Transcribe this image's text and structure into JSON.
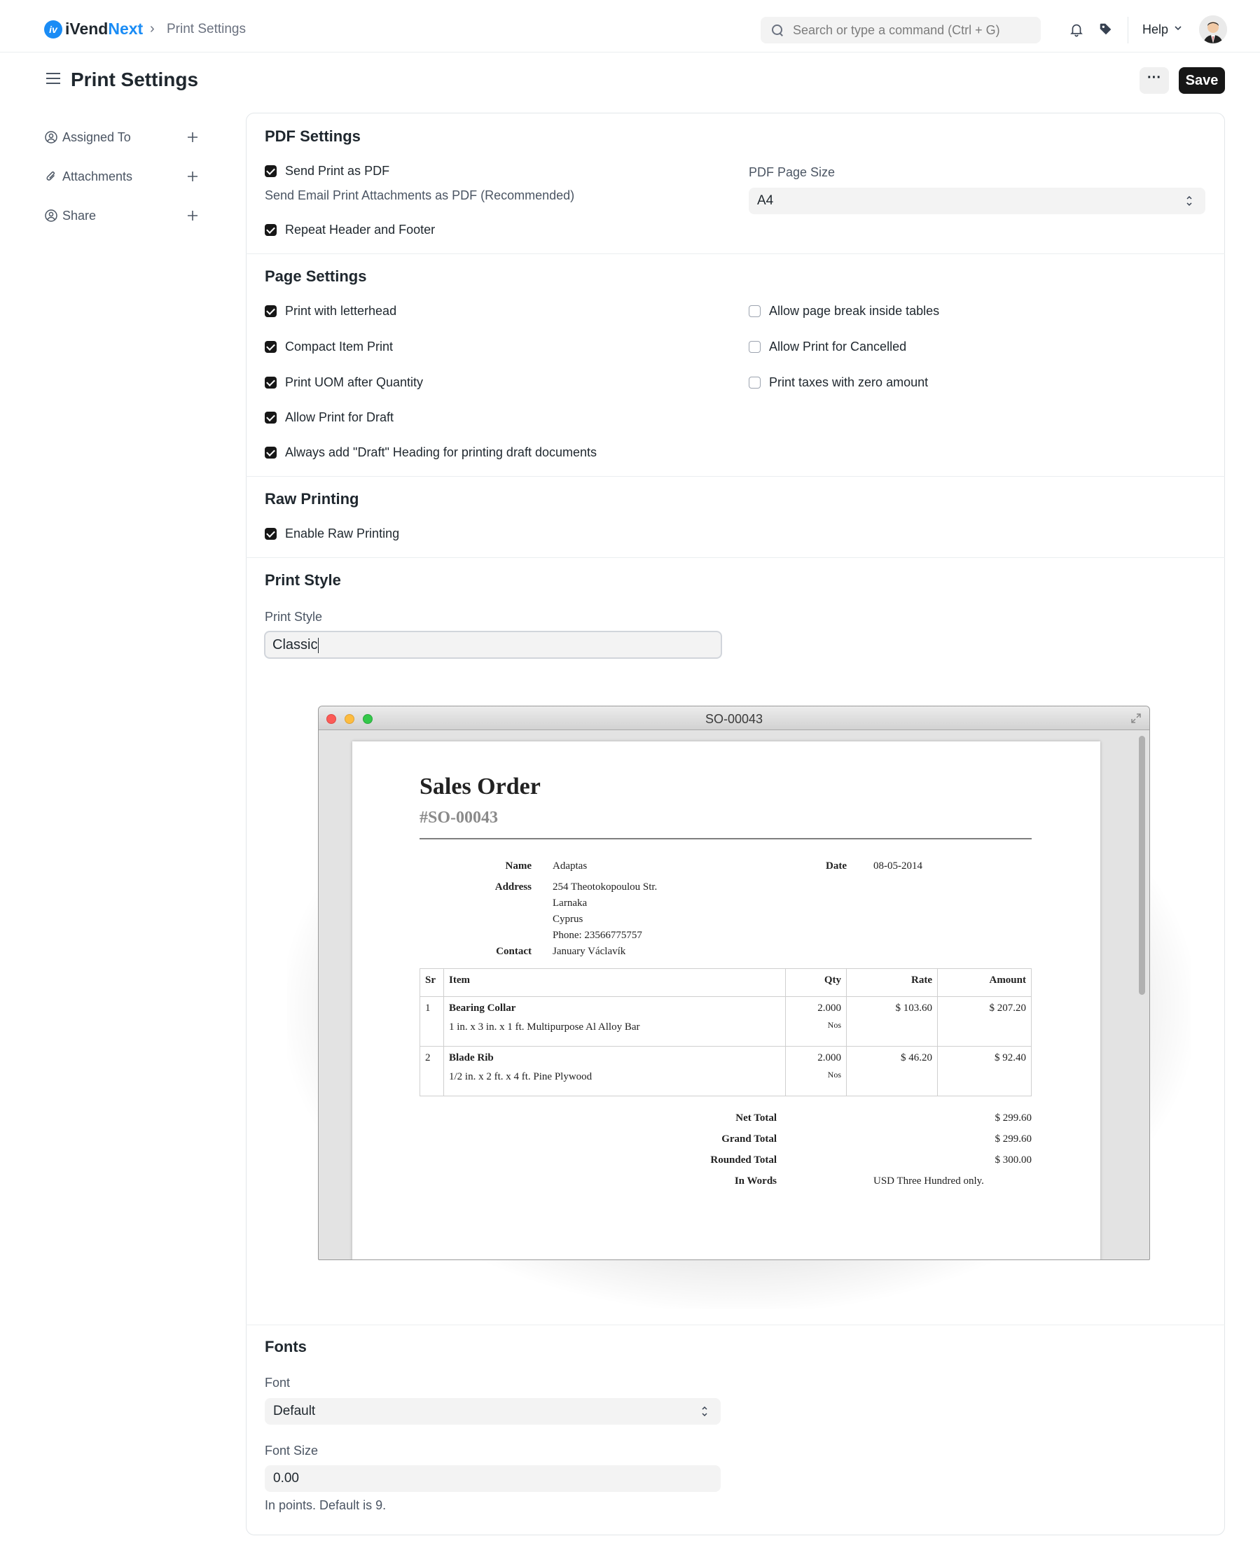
{
  "app": {
    "logo_mark": "iv",
    "logo_text_1": "iVend",
    "logo_text_2": "Next"
  },
  "breadcrumb": {
    "sep": "›",
    "current": "Print Settings"
  },
  "search": {
    "placeholder": "Search or type a command (Ctrl + G)"
  },
  "nav": {
    "help_label": "Help"
  },
  "page": {
    "title": "Print Settings",
    "more_label": "···",
    "save_label": "Save"
  },
  "sidebar": {
    "items": [
      {
        "label": "Assigned To",
        "icon": "user-add-icon"
      },
      {
        "label": "Attachments",
        "icon": "paperclip-icon"
      },
      {
        "label": "Share",
        "icon": "share-user-icon"
      }
    ]
  },
  "pdf_settings": {
    "title": "PDF Settings",
    "send_print_as_pdf": {
      "label": "Send Print as PDF",
      "checked": true
    },
    "send_print_help": "Send Email Print Attachments as PDF (Recommended)",
    "repeat_header_footer": {
      "label": "Repeat Header and Footer",
      "checked": true
    },
    "page_size_label": "PDF Page Size",
    "page_size_value": "A4"
  },
  "page_settings": {
    "title": "Page Settings",
    "left": [
      {
        "label": "Print with letterhead",
        "checked": true
      },
      {
        "label": "Compact Item Print",
        "checked": true
      },
      {
        "label": "Print UOM after Quantity",
        "checked": true
      },
      {
        "label": "Allow Print for Draft",
        "checked": true
      },
      {
        "label": "Always add \"Draft\" Heading for printing draft documents",
        "checked": true
      }
    ],
    "right": [
      {
        "label": "Allow page break inside tables",
        "checked": false
      },
      {
        "label": "Allow Print for Cancelled",
        "checked": false
      },
      {
        "label": "Print taxes with zero amount",
        "checked": false
      }
    ]
  },
  "raw_printing": {
    "title": "Raw Printing",
    "enable": {
      "label": "Enable Raw Printing",
      "checked": true
    }
  },
  "print_style": {
    "title": "Print Style",
    "field_label": "Print Style",
    "value": "Classic"
  },
  "preview": {
    "window_title": "SO-00043",
    "doc_title": "Sales Order",
    "doc_number": "#SO-00043",
    "name_label": "Name",
    "name_value": "Adaptas",
    "date_label": "Date",
    "date_value": "08-05-2014",
    "address_label": "Address",
    "address_lines": [
      "254 Theotokopoulou Str.",
      "Larnaka",
      "Cyprus",
      "Phone: 23566775757"
    ],
    "contact_label": "Contact",
    "contact_value": "January Václavík",
    "table": {
      "headers": [
        "Sr",
        "Item",
        "Qty",
        "Rate",
        "Amount"
      ],
      "rows": [
        {
          "sr": "1",
          "item": "Bearing Collar",
          "desc": "1 in. x 3 in. x 1 ft. Multipurpose Al Alloy Bar",
          "qty": "2.000",
          "uom": "Nos",
          "rate": "$ 103.60",
          "amount": "$ 207.20"
        },
        {
          "sr": "2",
          "item": "Blade Rib",
          "desc": "1/2 in. x 2 ft. x 4 ft. Pine Plywood",
          "qty": "2.000",
          "uom": "Nos",
          "rate": "$ 46.20",
          "amount": "$ 92.40"
        }
      ]
    },
    "totals": [
      {
        "label": "Net Total",
        "value": "$ 299.60"
      },
      {
        "label": "Grand Total",
        "value": "$ 299.60"
      },
      {
        "label": "Rounded Total",
        "value": "$ 300.00"
      },
      {
        "label": "In Words",
        "value": "USD Three Hundred only."
      }
    ]
  },
  "fonts": {
    "title": "Fonts",
    "font_label": "Font",
    "font_value": "Default",
    "size_label": "Font Size",
    "size_value": "0.00",
    "size_help": "In points. Default is 9."
  }
}
